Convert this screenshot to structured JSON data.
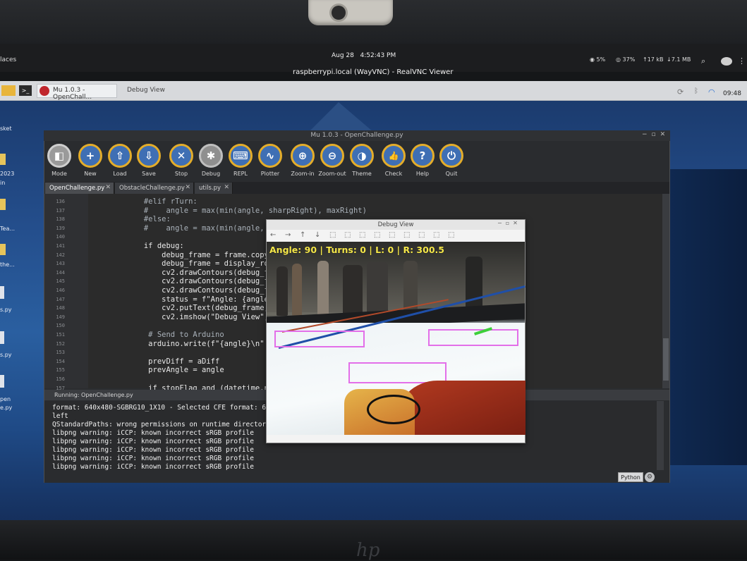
{
  "host": {
    "places": "laces",
    "date": "Aug 28",
    "time": "4:52:43 PM",
    "window_title": "raspberrypi.local (WayVNC) - RealVNC Viewer",
    "cpu": "5%",
    "memory": "37%",
    "upload": "↑17 kB",
    "download": "↓7.1 MB"
  },
  "pi_taskbar": {
    "task_mu": "Mu 1.0.3 - OpenChall...",
    "task_debug": "Debug View",
    "clock": "09:48"
  },
  "desktop_labels": [
    "sket",
    "2023",
    "in",
    "Tea...",
    "the...",
    "s.py",
    "s.py",
    "pen",
    "e.py"
  ],
  "mu": {
    "title": "Mu 1.0.3 - OpenChallenge.py",
    "toolbar": [
      {
        "label": "Mode",
        "icon": "mode-icon",
        "glyph": "◧"
      },
      {
        "label": "New",
        "icon": "plus-icon",
        "glyph": "+"
      },
      {
        "label": "Load",
        "icon": "load-icon",
        "glyph": "⇧"
      },
      {
        "label": "Save",
        "icon": "save-icon",
        "glyph": "⇩"
      },
      {
        "label": "Stop",
        "icon": "stop-icon",
        "glyph": "✕"
      },
      {
        "label": "Debug",
        "icon": "bug-icon",
        "glyph": "✱"
      },
      {
        "label": "REPL",
        "icon": "keyboard-icon",
        "glyph": "⌨"
      },
      {
        "label": "Plotter",
        "icon": "plotter-icon",
        "glyph": "∿"
      },
      {
        "label": "Zoom-in",
        "icon": "zoom-in-icon",
        "glyph": "⊕"
      },
      {
        "label": "Zoom-out",
        "icon": "zoom-out-icon",
        "glyph": "⊖"
      },
      {
        "label": "Theme",
        "icon": "theme-icon",
        "glyph": "◑"
      },
      {
        "label": "Check",
        "icon": "thumbs-up-icon",
        "glyph": "👍"
      },
      {
        "label": "Help",
        "icon": "help-icon",
        "glyph": "?"
      },
      {
        "label": "Quit",
        "icon": "power-icon",
        "glyph": "⏻"
      }
    ],
    "tabs": [
      {
        "label": "OpenChallenge.py",
        "close": "✕"
      },
      {
        "label": "ObstacleChallenge.py",
        "close": "✕"
      },
      {
        "label": "utils.py",
        "close": "✕"
      }
    ],
    "editor_lines": [
      {
        "n": "136",
        "text": "            #elif rTurn:",
        "cls": "cm"
      },
      {
        "n": "137",
        "text": "            #    angle = max(min(angle, sharpRight), maxRight)",
        "cls": "cm"
      },
      {
        "n": "138",
        "text": "            #else:",
        "cls": "cm"
      },
      {
        "n": "139",
        "text": "            #    angle = max(min(angle, sharpLeft),",
        "cls": "cm"
      },
      {
        "n": "140",
        "text": "",
        "cls": ""
      },
      {
        "n": "141",
        "text": "            if debug:",
        "cls": ""
      },
      {
        "n": "142",
        "text": "                debug_frame = frame.copy()",
        "cls": ""
      },
      {
        "n": "143",
        "text": "                debug_frame = display_roi(debug_fra",
        "cls": ""
      },
      {
        "n": "144",
        "text": "                cv2.drawContours(debug_frame[ROI1[",
        "cls": ""
      },
      {
        "n": "145",
        "text": "                cv2.drawContours(debug_frame[ROI2[",
        "cls": ""
      },
      {
        "n": "146",
        "text": "                cv2.drawContours(debug_frame[ROI3[",
        "cls": ""
      },
      {
        "n": "147",
        "text": "                status = f\"Angle: {angle} | Turns:",
        "cls": ""
      },
      {
        "n": "148",
        "text": "                cv2.putText(debug_frame, status, (",
        "cls": ""
      },
      {
        "n": "149",
        "text": "                cv2.imshow(\"Debug View\", debug_fram",
        "cls": ""
      },
      {
        "n": "150",
        "text": "",
        "cls": ""
      },
      {
        "n": "151",
        "text": "             # Send to Arduino",
        "cls": "cm"
      },
      {
        "n": "152",
        "text": "             arduino.write(f\"{angle}\\n\".encode())",
        "cls": ""
      },
      {
        "n": "153",
        "text": "",
        "cls": ""
      },
      {
        "n": "154",
        "text": "             prevDiff = aDiff",
        "cls": ""
      },
      {
        "n": "155",
        "text": "             prevAngle = angle",
        "cls": ""
      },
      {
        "n": "156",
        "text": "",
        "cls": ""
      },
      {
        "n": "157",
        "text": "             if stopFlag and (datetime.now() - microsec",
        "cls": ""
      }
    ],
    "running_label": "Running: OpenChallenge.py",
    "output_lines": [
      "format: 640x480-SGBRG10_1X10 - Selected CFE format: 640x",
      "left",
      "QStandardPaths: wrong permissions on runtime directory /",
      "libpng warning: iCCP: known incorrect sRGB profile",
      "libpng warning: iCCP: known incorrect sRGB profile",
      "libpng warning: iCCP: known incorrect sRGB profile",
      "libpng warning: iCCP: known incorrect sRGB profile",
      "libpng warning: iCCP: known incorrect sRGB profile"
    ],
    "mode_button": "Python"
  },
  "debug_view": {
    "title": "Debug View",
    "overlay": "Angle: 90 | Turns: 0 | L: 0 | R: 300.5",
    "tools": [
      "←",
      "→",
      "↑",
      "↓",
      "⬚",
      "⬚",
      "⬚",
      "⬚",
      "⬚",
      "⬚",
      "⬚",
      "⬚",
      "⬚"
    ]
  }
}
